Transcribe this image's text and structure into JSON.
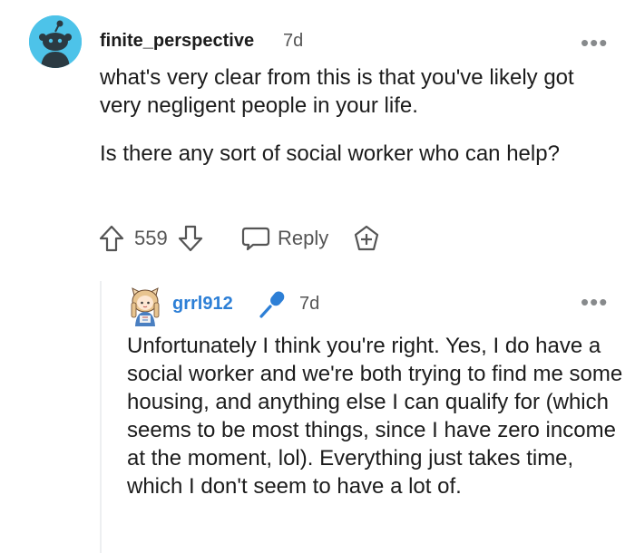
{
  "comment": {
    "author": "finite_perspective",
    "age": "7d",
    "paragraphs": [
      "what's very clear from this is that you've likely got very negligent people in your life.",
      "Is there any sort of social worker who can help?"
    ],
    "votes": "559",
    "reply_label": "Reply",
    "icons": {
      "avatar": "reddit-snoo-avatar-icon",
      "upvote": "upvote-arrow-icon",
      "downvote": "downvote-arrow-icon",
      "reply": "speech-bubble-icon",
      "award": "add-award-icon",
      "more": "more-options-icon"
    }
  },
  "reply": {
    "author": "grrl912",
    "age": "7d",
    "text": "Unfortunately I think you're right. Yes, I do have a social worker and we're both trying to find me some housing, and anything else I can qualify for (which seems to be most things, since I have zero income at the moment, lol). Everything just takes time, which I don't seem to have a lot of.",
    "icons": {
      "avatar": "cartoon-avatar-icon",
      "badge": "microphone-icon",
      "more": "more-options-icon"
    }
  },
  "colors": {
    "avatar_bg": "#4dc3e9",
    "reply_username": "#2d7fd6",
    "mic_badge": "#2d7fd6",
    "icon_gray": "#555555"
  }
}
